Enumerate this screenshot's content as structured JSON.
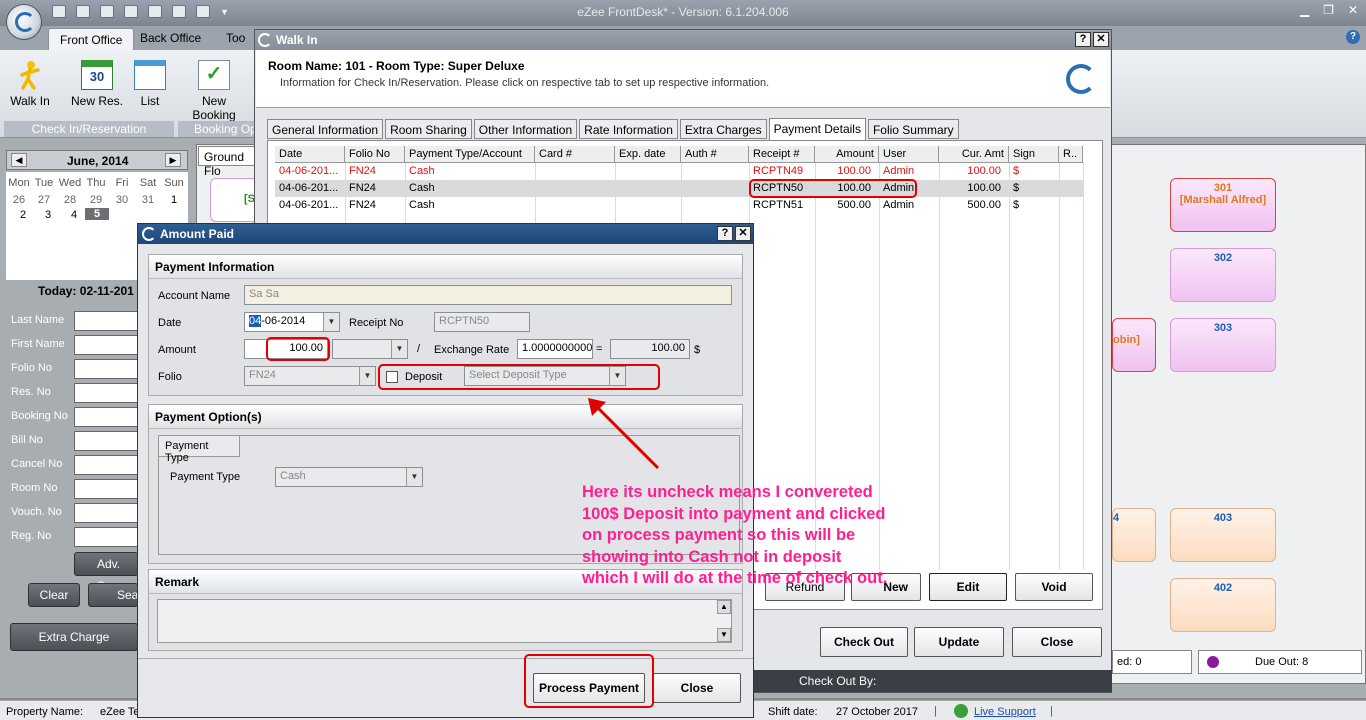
{
  "app": {
    "title": "eZee FrontDesk* - Version: 6.1.204.006"
  },
  "ribbon": {
    "tabs": [
      "Front Office",
      "Back Office",
      "Too"
    ],
    "buttons": [
      "Walk In",
      "New Res.",
      "List",
      "New Booking"
    ],
    "calendar_icon_day": "30",
    "groups": [
      "Check In/Reservation",
      "Booking Op"
    ]
  },
  "calendar": {
    "month": "June, 2014",
    "days": [
      "Mon",
      "Tue",
      "Wed",
      "Thu",
      "Fri",
      "Sat",
      "Sun"
    ],
    "row1": [
      "26",
      "27",
      "28",
      "29",
      "30",
      "31",
      "1"
    ],
    "row2": [
      "2",
      "3",
      "4",
      "5"
    ],
    "today": "Today: 02-11-201"
  },
  "search": {
    "labels": [
      "Last Name",
      "First Name",
      "Folio No",
      "Res. No",
      "Booking No",
      "Bill No",
      "Cancel No",
      "Room No",
      "Vouch. No",
      "Reg. No"
    ],
    "adv_search": "Adv. Se",
    "clear": "Clear",
    "search": "Sea",
    "extra_charge": "Extra Charge"
  },
  "floor": {
    "tab": "Ground Flo",
    "left_room_partial": "[S",
    "rooms": [
      {
        "num": "301",
        "guest": "[Marshall Alfred]"
      },
      {
        "num": "302"
      },
      {
        "num": "303"
      },
      {
        "num": "403"
      },
      {
        "num": "402"
      }
    ],
    "partial_guest": "obin]",
    "partial_num": "4",
    "status_left": "ed: 0",
    "due_out": "Due Out: 8"
  },
  "walkin": {
    "title": "Walk In",
    "room_header": "Room Name: 101 - Room Type: Super Deluxe",
    "info": "Information for Check In/Reservation. Please click on respective tab to set up respective information.",
    "tabs": [
      "General Information",
      "Room Sharing",
      "Other Information",
      "Rate Information",
      "Extra Charges",
      "Payment Details",
      "Folio Summary"
    ],
    "columns": [
      "Date",
      "Folio No",
      "Payment Type/Account",
      "Card #",
      "Exp. date",
      "Auth #",
      "Receipt #",
      "Amount",
      "User",
      "Cur. Amt",
      "Sign",
      "R.."
    ],
    "rows": [
      {
        "date": "04-06-201...",
        "folio": "FN24",
        "type": "Cash",
        "receipt": "RCPTN49",
        "amount": "100.00",
        "user": "Admin",
        "cur": "100.00",
        "sign": "$",
        "voided": true
      },
      {
        "date": "04-06-201...",
        "folio": "FN24",
        "type": "Cash",
        "receipt": "RCPTN50",
        "amount": "100.00",
        "user": "Admin",
        "cur": "100.00",
        "sign": "$",
        "voided": false
      },
      {
        "date": "04-06-201...",
        "folio": "FN24",
        "type": "Cash",
        "receipt": "RCPTN51",
        "amount": "500.00",
        "user": "Admin",
        "cur": "500.00",
        "sign": "$",
        "voided": false
      }
    ],
    "grid_buttons": [
      "Refund",
      "New",
      "Edit",
      "Void"
    ],
    "footer_buttons": [
      "Check Out",
      "Update",
      "Close"
    ],
    "check_out_by": "Check Out By:"
  },
  "amount_paid": {
    "title": "Amount Paid",
    "payment_info_header": "Payment Information",
    "account_name_label": "Account Name",
    "account_name": "Sa Sa",
    "date_label": "Date",
    "date_sel": "04",
    "date_rest": "-06-2014",
    "receipt_label": "Receipt No",
    "receipt": "RCPTN50",
    "amount_label": "Amount",
    "amount": "100.00",
    "exchange_label": "Exchange Rate",
    "exchange": "1.0000000000",
    "equals": "=",
    "slash": "/",
    "converted": "100.00",
    "currency": "$",
    "folio_label": "Folio",
    "folio": "FN24",
    "deposit_label": "Deposit",
    "deposit_placeholder": "Select Deposit Type",
    "payment_options_header": "Payment Option(s)",
    "payment_type_tab": "Payment Type",
    "payment_type_label": "Payment Type",
    "payment_type": "Cash",
    "remark_header": "Remark",
    "process_button": "Process Payment",
    "close_button": "Close"
  },
  "annotation": {
    "text": "Here its uncheck means I convereted 100$ Deposit into payment and clicked on process payment so this will be showing into Cash not in deposit which I will do at the time of check out."
  },
  "statusbar": {
    "property_label": "Property Name:",
    "property": "eZee Te",
    "shift_label": "Shift date:",
    "shift": "27 October 2017",
    "live_support": "Live Support"
  },
  "colors": {
    "annotation": "#ff1f8f",
    "highlight": "#e00000",
    "dialog_title": "#1f4677"
  }
}
